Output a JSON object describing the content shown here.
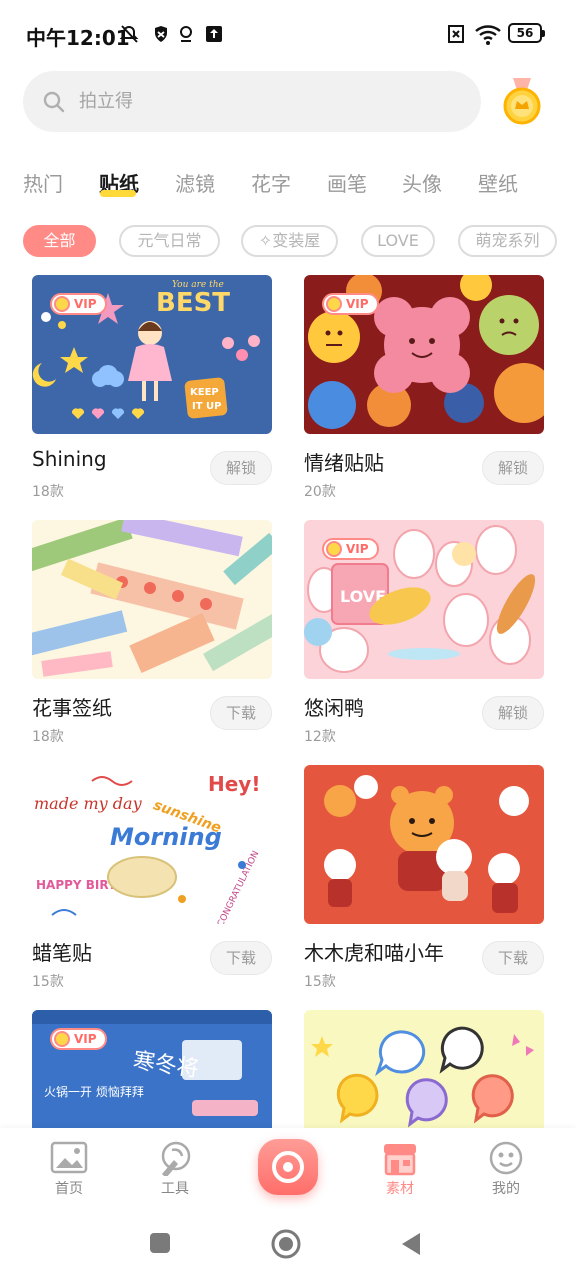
{
  "status_bar": {
    "time": "中午12:01",
    "battery": "56"
  },
  "search": {
    "placeholder": "拍立得"
  },
  "tabs": [
    {
      "label": "热门",
      "active": false
    },
    {
      "label": "贴纸",
      "active": true
    },
    {
      "label": "滤镜",
      "active": false
    },
    {
      "label": "花字",
      "active": false
    },
    {
      "label": "画笔",
      "active": false
    },
    {
      "label": "头像",
      "active": false
    },
    {
      "label": "壁纸",
      "active": false
    }
  ],
  "chips": [
    {
      "label": "全部",
      "active": true
    },
    {
      "label": "元气日常",
      "active": false
    },
    {
      "label": "✧变装屋",
      "active": false
    },
    {
      "label": "LOVE",
      "active": false
    },
    {
      "label": "萌宠系列",
      "active": false
    }
  ],
  "cards": [
    {
      "title": "Shining",
      "count": "18款",
      "button": "解锁",
      "vip": "VIP",
      "image_text": [
        "You are the",
        "BEST",
        "KEEP IT UP"
      ]
    },
    {
      "title": "情绪贴贴",
      "count": "20款",
      "button": "解锁",
      "vip": "VIP"
    },
    {
      "title": "花事签纸",
      "count": "18款",
      "button": "下载"
    },
    {
      "title": "悠闲鸭",
      "count": "12款",
      "button": "解锁",
      "vip": "VIP",
      "image_text": [
        "LOVE"
      ]
    },
    {
      "title": "蜡笔贴",
      "count": "15款",
      "button": "下载",
      "image_text": [
        "Hey!",
        "made my day",
        "Morning",
        "sunshine",
        "HAPPY BIRTH DAY",
        "CONGRATULATION"
      ]
    },
    {
      "title": "木木虎和喵小年",
      "count": "15款",
      "button": "下载"
    },
    {
      "title": "",
      "count": "",
      "button": "",
      "vip": "VIP",
      "image_text": [
        "火锅一开 烦恼拜拜",
        "寒冬将"
      ]
    },
    {
      "title": "",
      "count": "",
      "button": ""
    }
  ],
  "bottom_nav": [
    {
      "label": "首页",
      "icon": "image-icon",
      "active": false
    },
    {
      "label": "工具",
      "icon": "tools-icon",
      "active": false
    },
    {
      "label": "素材",
      "icon": "store-icon",
      "active": true
    },
    {
      "label": "我的",
      "icon": "face-icon",
      "active": false
    }
  ],
  "colors": {
    "accent": "#ff8a86",
    "tab_underline": "#ffd83a"
  }
}
